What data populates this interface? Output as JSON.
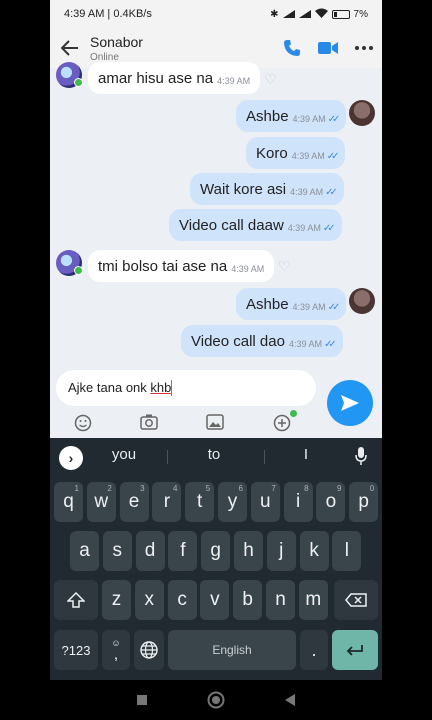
{
  "status_bar": {
    "time": "4:39 AM",
    "speed": "0.4KB/s",
    "battery": "7%"
  },
  "header": {
    "contact_name": "Sonabor",
    "contact_status": "Online"
  },
  "messages": [
    {
      "text": "amar hisu ase na",
      "time": "4:39 AM",
      "direction": "incoming"
    },
    {
      "text": "Ashbe",
      "time": "4:39 AM",
      "direction": "outgoing",
      "ticks": "read"
    },
    {
      "text": "Koro",
      "time": "4:39 AM",
      "direction": "outgoing",
      "ticks": "read"
    },
    {
      "text": "Wait kore asi",
      "time": "4:39 AM",
      "direction": "outgoing",
      "ticks": "read"
    },
    {
      "text": "Video call daaw",
      "time": "4:39 AM",
      "direction": "outgoing",
      "ticks": "read"
    },
    {
      "text": "tmi bolso tai ase na",
      "time": "4:39 AM",
      "direction": "incoming"
    },
    {
      "text": "Ashbe",
      "time": "4:39 AM",
      "direction": "outgoing",
      "ticks": "read"
    },
    {
      "text": "Video call dao",
      "time": "4:39 AM",
      "direction": "outgoing",
      "ticks": "read"
    }
  ],
  "composer": {
    "text_before": "Ajke tana onk ",
    "text_misspelled": "khb"
  },
  "keyboard": {
    "suggestions": [
      "you",
      "to",
      "I"
    ],
    "row1": [
      {
        "key": "q",
        "hint": "1"
      },
      {
        "key": "w",
        "hint": "2"
      },
      {
        "key": "e",
        "hint": "3"
      },
      {
        "key": "r",
        "hint": "4"
      },
      {
        "key": "t",
        "hint": "5"
      },
      {
        "key": "y",
        "hint": "6"
      },
      {
        "key": "u",
        "hint": "7"
      },
      {
        "key": "i",
        "hint": "8"
      },
      {
        "key": "o",
        "hint": "9"
      },
      {
        "key": "p",
        "hint": "0"
      }
    ],
    "row2": [
      "a",
      "s",
      "d",
      "f",
      "g",
      "h",
      "j",
      "k",
      "l"
    ],
    "row3": [
      "z",
      "x",
      "c",
      "v",
      "b",
      "n",
      "m"
    ],
    "symbols_label": "?123",
    "comma_label": ",",
    "space_label": "English",
    "period_label": "."
  },
  "colors": {
    "accent": "#2196f3",
    "outgoing_bubble": "#cfe3fb",
    "keyboard_bg": "#202a30",
    "enter_key": "#6fb5a8"
  }
}
